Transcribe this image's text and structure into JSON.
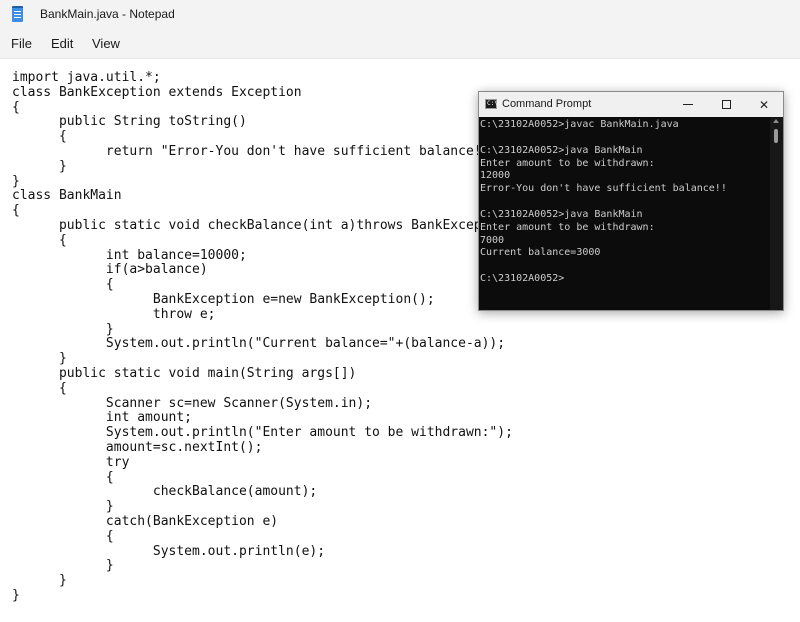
{
  "notepad": {
    "title": "BankMain.java - Notepad",
    "icon": "notepad-icon",
    "menu": [
      "File",
      "Edit",
      "View"
    ],
    "code": "import java.util.*;\nclass BankException extends Exception\n{\n      public String toString()\n      {\n            return \"Error-You don't have sufficient balance!!\";\n      }\n}\nclass BankMain\n{\n      public static void checkBalance(int a)throws BankException\n      {\n            int balance=10000;\n            if(a>balance)\n            {\n                  BankException e=new BankException();\n                  throw e;\n            }\n            System.out.println(\"Current balance=\"+(balance-a));\n      }\n      public static void main(String args[])\n      {\n            Scanner sc=new Scanner(System.in);\n            int amount;\n            System.out.println(\"Enter amount to be withdrawn:\");\n            amount=sc.nextInt();\n            try\n            {\n                  checkBalance(amount);\n            }\n            catch(BankException e)\n            {\n                  System.out.println(e);\n            }\n      }\n}"
  },
  "cmd": {
    "title": "Command Prompt",
    "icon": "cmd-icon",
    "icon_text": "C:\\",
    "controls": {
      "minimize": "minimize-icon",
      "maximize": "maximize-icon",
      "close": "✕"
    },
    "output": "C:\\23102A0052>javac BankMain.java\n\nC:\\23102A0052>java BankMain\nEnter amount to be withdrawn:\n12000\nError-You don't have sufficient balance!!\n\nC:\\23102A0052>java BankMain\nEnter amount to be withdrawn:\n7000\nCurrent balance=3000\n\nC:\\23102A0052>"
  }
}
